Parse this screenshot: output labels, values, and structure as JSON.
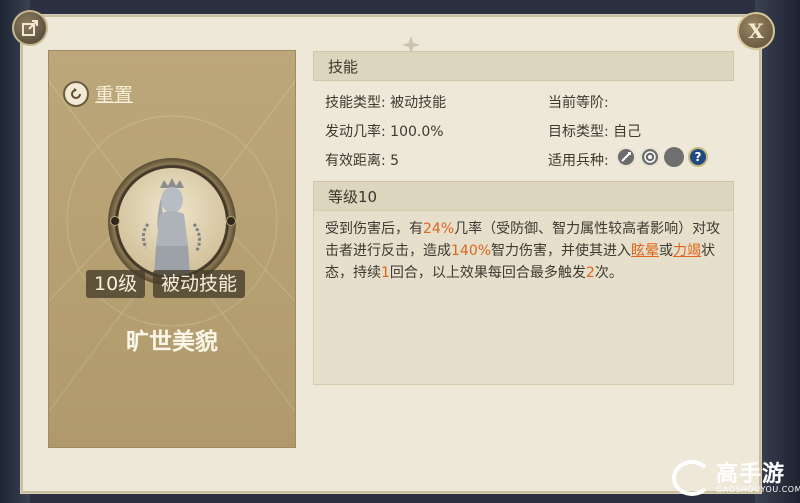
{
  "buttons": {
    "close_label": "X"
  },
  "left": {
    "reset_label": "重置",
    "level": "10级",
    "skill_type_tag": "被动技能",
    "skill_name": "旷世美貌"
  },
  "info": {
    "section_title": "技能",
    "skill_type_label": "技能类型:",
    "skill_type_value": "被动技能",
    "current_level_label": "当前等阶:",
    "trigger_rate_label": "发动几率:",
    "trigger_rate_value": "100.0%",
    "target_type_label": "目标类型:",
    "target_type_value": "自己",
    "range_label": "有效距离:",
    "range_value": "5",
    "unit_types_label": "适用兵种:",
    "unit_type_icons": [
      "sword-icon",
      "target-icon",
      "circle-icon",
      "question-icon"
    ]
  },
  "level_section": {
    "title": "等级10",
    "desc_1": "受到伤害后，有",
    "chance": "24%",
    "desc_2": "几率（受防御、智力属性较高者影响）对攻击者进行反击，造成",
    "damage": "140%",
    "desc_3": "智力伤害，并使其进入",
    "status_1": "眩晕",
    "desc_4": "或",
    "status_2": "力竭",
    "desc_5": "状态，持续",
    "duration": "1",
    "desc_6": "回合，以上效果每回合最多触发",
    "max_triggers": "2",
    "desc_7": "次。"
  },
  "watermark": {
    "brand": "高手游",
    "domain": "GAOSHOUYOU.COM"
  },
  "colors": {
    "highlight": "#e0651c",
    "panel_gold": "#b5a071",
    "dialog_bg": "#ede8d8"
  }
}
